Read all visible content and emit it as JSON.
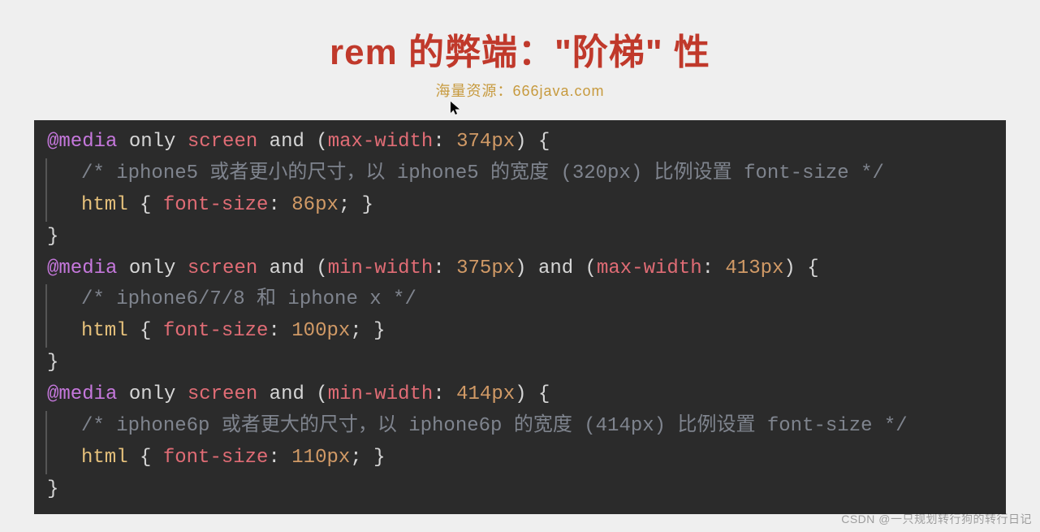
{
  "title": "rem 的弊端：\"阶梯\" 性",
  "subtitle": "海量资源：666java.com",
  "watermark": "CSDN @一只规划转行狗的转行日记",
  "code": {
    "block1": {
      "at": "@media",
      "only": " only ",
      "screen": "screen",
      "and1": " and (",
      "maxw": "max-width",
      "sep1": ": ",
      "v1": "374px",
      "close1": ") {",
      "comment": "/* iphone5 或者更小的尺寸，以 iphone5 的宽度 (320px) 比例设置 font-size */",
      "sel": "html",
      "body_open": " { ",
      "prop": "font-size",
      "psep": ": ",
      "val": "86px",
      "body_close": "; }",
      "end": "}"
    },
    "block2": {
      "at": "@media",
      "only": " only ",
      "screen": "screen",
      "and1": " and (",
      "minw": "min-width",
      "sep1": ": ",
      "v1": "375px",
      "mid": ") and (",
      "maxw": "max-width",
      "sep2": ": ",
      "v2": "413px",
      "close1": ") {",
      "comment": "/* iphone6/7/8 和 iphone x */",
      "sel": "html",
      "body_open": " { ",
      "prop": "font-size",
      "psep": ": ",
      "val": "100px",
      "body_close": "; }",
      "end": "}"
    },
    "block3": {
      "at": "@media",
      "only": " only ",
      "screen": "screen",
      "and1": " and (",
      "minw": "min-width",
      "sep1": ": ",
      "v1": "414px",
      "close1": ") {",
      "comment": "/* iphone6p 或者更大的尺寸，以 iphone6p 的宽度 (414px) 比例设置 font-size */",
      "sel": "html",
      "body_open": " { ",
      "prop": "font-size",
      "psep": ": ",
      "val": "110px",
      "body_close": "; }",
      "end": "}"
    }
  }
}
